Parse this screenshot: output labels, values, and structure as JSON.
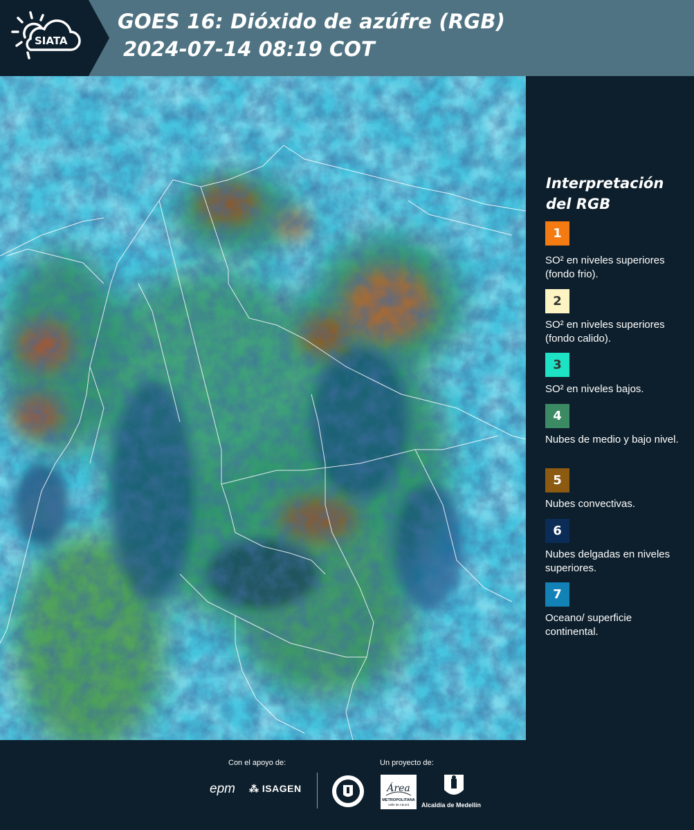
{
  "header": {
    "logo_text": "SIATA",
    "title_line1": "GOES 16: Dióxido de azúfre (RGB)",
    "title_line2": "2024-07-14 08:19 COT"
  },
  "legend": {
    "title": "Interpretación del RGB",
    "items": [
      {
        "number": "1",
        "color": "#f47a12",
        "text": "SO² en niveles superiores (fondo frio)."
      },
      {
        "number": "2",
        "color": "#fdf4c3",
        "text": "SO² en niveles superiores (fondo calido)."
      },
      {
        "number": "3",
        "color": "#1de2c3",
        "text": "SO² en niveles bajos."
      },
      {
        "number": "4",
        "color": "#3b8a63",
        "text": "Nubes de medio y bajo nivel."
      },
      {
        "number": "5",
        "color": "#8c5a10",
        "text": "Nubes convectivas."
      },
      {
        "number": "6",
        "color": "#0a2c57",
        "text": "Nubes delgadas en niveles superiores."
      },
      {
        "number": "7",
        "color": "#1282b6",
        "text": "Oceano/ superficie continental."
      }
    ]
  },
  "footer": {
    "support_label": "Con el apoyo de:",
    "project_label": "Un proyecto de:",
    "epm_logo_text": "epm",
    "isagen_logo_text": "ISAGEN",
    "area_logo_text": "Área",
    "area_logo_subtext": "METROPOLITANA",
    "area_logo_subtext2": "Valle de Aburrá",
    "alcaldia_text": "Alcaldía de Medellín"
  },
  "map": {
    "icon": "satellite-rgb-image",
    "ocean_color": "#44c3e0",
    "land_color": "#2f8b63",
    "convective_color": "#8c5a2a"
  }
}
